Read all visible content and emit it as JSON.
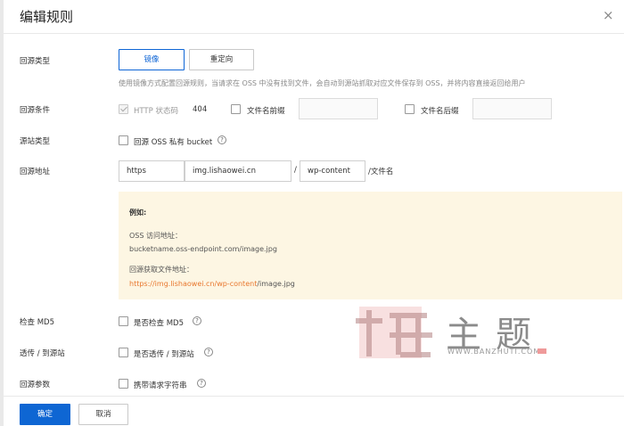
{
  "dialog": {
    "title": "编辑规则",
    "close_icon": "×"
  },
  "fields": {
    "origin_type": {
      "label": "回源类型",
      "options": [
        "镜像",
        "重定向"
      ],
      "selected": "镜像",
      "hint": "使用镜像方式配置回源规则，当请求在 OSS 中没有找到文件，会自动到源站抓取对应文件保存到 OSS，并将内容直接返回给用户"
    },
    "origin_condition": {
      "label": "回源条件",
      "http_status_label": "HTTP 状态码",
      "http_status_value": "404",
      "prefix_label": "文件名前缀",
      "suffix_label": "文件名后缀"
    },
    "origin_site_type": {
      "label": "源站类型",
      "checkbox_label": "回源 OSS 私有 bucket"
    },
    "origin_address": {
      "label": "回源地址",
      "protocol": "https",
      "domain": "img.lishaowei.cn",
      "separator": "/",
      "path": "wp-content",
      "suffix": "/文件名"
    },
    "example": {
      "heading": "例如:",
      "oss_label": "OSS 访问地址：",
      "oss_url": "bucketname.oss-endpoint.com/image.jpg",
      "fetch_label": "回源获取文件地址：",
      "fetch_url_highlight": "https://img.lishaowei.cn/wp-content",
      "fetch_url_tail": "/image.jpg"
    },
    "check_md5": {
      "label": "检查 MD5",
      "checkbox_label": "是否检查 MD5"
    },
    "passthrough": {
      "label": "透传 / 到源站",
      "checkbox_label": "是否透传 / 到源站"
    },
    "origin_params": {
      "label": "回源参数",
      "checkbox_label": "携带请求字符串"
    }
  },
  "footer": {
    "confirm_label": "确定",
    "cancel_label": "取消"
  },
  "watermark": {
    "text": "主题",
    "sub": "WWW.BANZHUTI.COM"
  },
  "colors": {
    "primary": "#0e66d3",
    "example_bg": "#fdf6e3",
    "link": "#e8772e"
  }
}
